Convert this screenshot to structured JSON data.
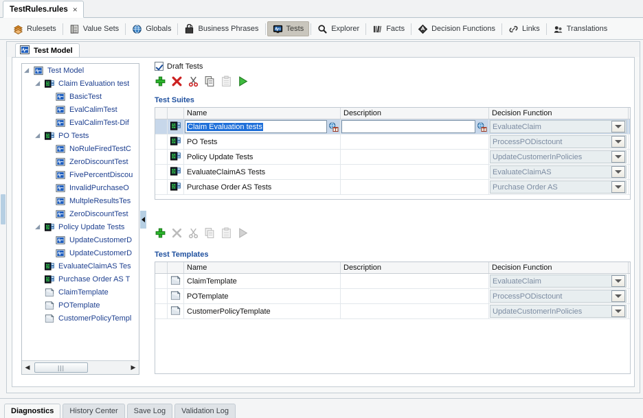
{
  "document_tab": {
    "title": "TestRules.rules",
    "close": "×"
  },
  "toolbar": {
    "items": [
      {
        "label": "Rulesets",
        "icon": "rulesets-icon",
        "selected": false
      },
      {
        "label": "Value Sets",
        "icon": "value-sets-icon",
        "selected": false
      },
      {
        "label": "Globals",
        "icon": "globals-icon",
        "selected": false
      },
      {
        "label": "Business Phrases",
        "icon": "business-phrases-icon",
        "selected": false
      },
      {
        "label": "Tests",
        "icon": "tests-icon",
        "selected": true
      },
      {
        "label": "Explorer",
        "icon": "explorer-icon",
        "selected": false
      },
      {
        "label": "Facts",
        "icon": "facts-icon",
        "selected": false
      },
      {
        "label": "Decision Functions",
        "icon": "decision-functions-icon",
        "selected": false
      },
      {
        "label": "Links",
        "icon": "links-icon",
        "selected": false
      },
      {
        "label": "Translations",
        "icon": "translations-icon",
        "selected": false
      }
    ]
  },
  "inner_tab": {
    "label": "Test Model",
    "icon": "test-model-icon"
  },
  "tree": {
    "nodes": [
      {
        "label": "Test Model",
        "indent": 0,
        "icon": "test-model-icon",
        "twisty": "open"
      },
      {
        "label": "Claim Evaluation test",
        "indent": 1,
        "icon": "test-suite-icon",
        "twisty": "open"
      },
      {
        "label": "BasicTest",
        "indent": 2,
        "icon": "test-icon",
        "twisty": "none"
      },
      {
        "label": "EvalCalimTest",
        "indent": 2,
        "icon": "test-icon",
        "twisty": "none"
      },
      {
        "label": "EvalCalimTest-Dif",
        "indent": 2,
        "icon": "test-icon",
        "twisty": "none"
      },
      {
        "label": "PO Tests",
        "indent": 1,
        "icon": "test-suite-icon",
        "twisty": "open"
      },
      {
        "label": "NoRuleFiredTestC",
        "indent": 2,
        "icon": "test-icon",
        "twisty": "none"
      },
      {
        "label": "ZeroDiscountTest",
        "indent": 2,
        "icon": "test-icon",
        "twisty": "none"
      },
      {
        "label": "FivePercentDiscou",
        "indent": 2,
        "icon": "test-icon",
        "twisty": "none"
      },
      {
        "label": "InvalidPurchaseO",
        "indent": 2,
        "icon": "test-icon",
        "twisty": "none"
      },
      {
        "label": "MultpleResultsTes",
        "indent": 2,
        "icon": "test-icon",
        "twisty": "none"
      },
      {
        "label": "ZeroDiscountTest",
        "indent": 2,
        "icon": "test-icon",
        "twisty": "none"
      },
      {
        "label": "Policy Update Tests",
        "indent": 1,
        "icon": "test-suite-icon",
        "twisty": "open"
      },
      {
        "label": "UpdateCustomerD",
        "indent": 2,
        "icon": "test-icon",
        "twisty": "none"
      },
      {
        "label": "UpdateCustomerD",
        "indent": 2,
        "icon": "test-icon",
        "twisty": "none"
      },
      {
        "label": "EvaluateClaimAS Tes",
        "indent": 1,
        "icon": "test-suite-icon",
        "twisty": "none"
      },
      {
        "label": "Purchase Order AS T",
        "indent": 1,
        "icon": "test-suite-icon",
        "twisty": "none"
      },
      {
        "label": "ClaimTemplate",
        "indent": 1,
        "icon": "template-icon",
        "twisty": "none"
      },
      {
        "label": "POTemplate",
        "indent": 1,
        "icon": "template-icon",
        "twisty": "none"
      },
      {
        "label": "CustomerPolicyTempl",
        "indent": 1,
        "icon": "template-icon",
        "twisty": "none"
      }
    ],
    "hscroll_grip": "|||"
  },
  "draft_tests": {
    "label": "Draft Tests",
    "checked": true
  },
  "suite_toolbar": {
    "buttons": [
      {
        "name": "add-button",
        "icon": "plus-icon",
        "enabled": true
      },
      {
        "name": "delete-button",
        "icon": "delete-icon",
        "enabled": true
      },
      {
        "name": "cut-button",
        "icon": "cut-icon",
        "enabled": true
      },
      {
        "name": "copy-button",
        "icon": "copy-icon",
        "enabled": true
      },
      {
        "name": "paste-button",
        "icon": "paste-icon",
        "enabled": false
      },
      {
        "name": "run-button",
        "icon": "run-icon",
        "enabled": true
      }
    ]
  },
  "template_toolbar": {
    "buttons": [
      {
        "name": "add-button",
        "icon": "plus-icon",
        "enabled": true
      },
      {
        "name": "delete-button",
        "icon": "delete-icon",
        "enabled": false
      },
      {
        "name": "cut-button",
        "icon": "cut-icon",
        "enabled": false
      },
      {
        "name": "copy-button",
        "icon": "copy-icon",
        "enabled": false
      },
      {
        "name": "paste-button",
        "icon": "paste-icon",
        "enabled": false
      },
      {
        "name": "run-button",
        "icon": "run-icon",
        "enabled": false
      }
    ]
  },
  "test_suites": {
    "title": "Test Suites",
    "columns": [
      "",
      "",
      "Name",
      "Description",
      "Decision Function"
    ],
    "editing_row": 0,
    "editing_value": "Claim Evaluation tests",
    "editing_description": "",
    "rows": [
      {
        "name": "Claim Evaluation tests",
        "description": "",
        "decision_function": "EvaluateClaim",
        "icon": "test-suite-icon",
        "selected": true
      },
      {
        "name": "PO Tests",
        "description": "",
        "decision_function": "ProcessPODisctount",
        "icon": "test-suite-icon",
        "selected": false
      },
      {
        "name": "Policy Update Tests",
        "description": "",
        "decision_function": "UpdateCustomerInPolicies",
        "icon": "test-suite-icon",
        "selected": false
      },
      {
        "name": "EvaluateClaimAS Tests",
        "description": "",
        "decision_function": "EvaluateClaimAS",
        "icon": "test-suite-icon",
        "selected": false
      },
      {
        "name": "Purchase Order AS Tests",
        "description": "",
        "decision_function": "Purchase Order AS",
        "icon": "test-suite-icon",
        "selected": false
      }
    ]
  },
  "test_templates": {
    "title": "Test Templates",
    "columns": [
      "",
      "",
      "Name",
      "Description",
      "Decision Function"
    ],
    "rows": [
      {
        "name": "ClaimTemplate",
        "description": "",
        "decision_function": "EvaluateClaim",
        "icon": "template-icon"
      },
      {
        "name": "POTemplate",
        "description": "",
        "decision_function": "ProcessPODisctount",
        "icon": "template-icon"
      },
      {
        "name": "CustomerPolicyTemplate",
        "description": "",
        "decision_function": "UpdateCustomerInPolicies",
        "icon": "template-icon"
      }
    ]
  },
  "log_tabs": [
    {
      "label": "Diagnostics",
      "active": true
    },
    {
      "label": "History Center",
      "active": false
    },
    {
      "label": "Save Log",
      "active": false
    },
    {
      "label": "Validation Log",
      "active": false
    }
  ],
  "colors": {
    "accent_blue": "#1e4f9e",
    "selection_blue": "#1e6fd9",
    "row_select": "#c7d7ea",
    "tree_text": "#1d3f8f",
    "combo_text": "#7b8ba1"
  }
}
